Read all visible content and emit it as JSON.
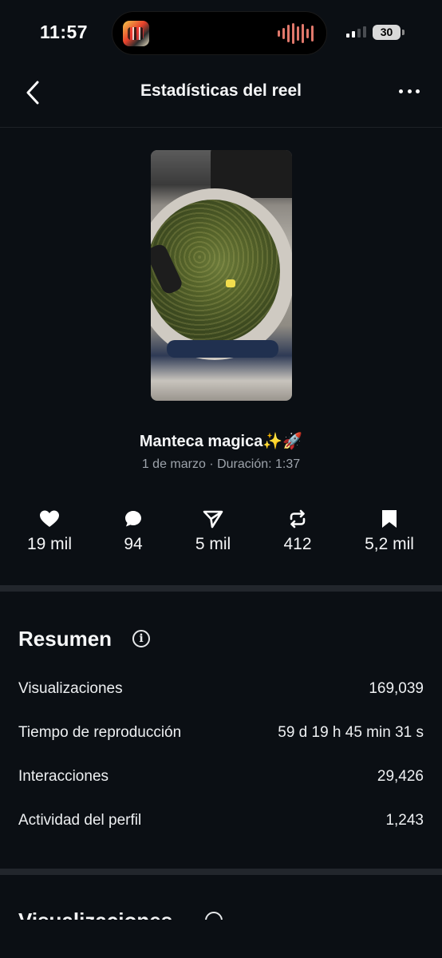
{
  "status_bar": {
    "time": "11:57",
    "battery": "30"
  },
  "nav": {
    "title": "Estadísticas del reel"
  },
  "reel": {
    "title": "Manteca magica✨🚀",
    "meta": "1 de marzo · Duración: 1:37"
  },
  "stats": [
    {
      "icon": "heart-icon",
      "value": "19 mil"
    },
    {
      "icon": "comment-icon",
      "value": "94"
    },
    {
      "icon": "send-icon",
      "value": "5 mil"
    },
    {
      "icon": "repost-icon",
      "value": "412"
    },
    {
      "icon": "bookmark-icon",
      "value": "5,2 mil"
    }
  ],
  "summary": {
    "title": "Resumen",
    "rows": [
      {
        "label": "Visualizaciones",
        "value": "169,039"
      },
      {
        "label": "Tiempo de reproducción",
        "value": "59 d 19 h 45 min 31 s"
      },
      {
        "label": "Interacciones",
        "value": "29,426"
      },
      {
        "label": "Actividad del perfil",
        "value": "1,243"
      }
    ]
  },
  "next_section": {
    "title": "Visualizaciones"
  },
  "colors": {
    "background": "#0b0f14",
    "divider": "#22262c",
    "secondary_text": "#9da3ab"
  }
}
